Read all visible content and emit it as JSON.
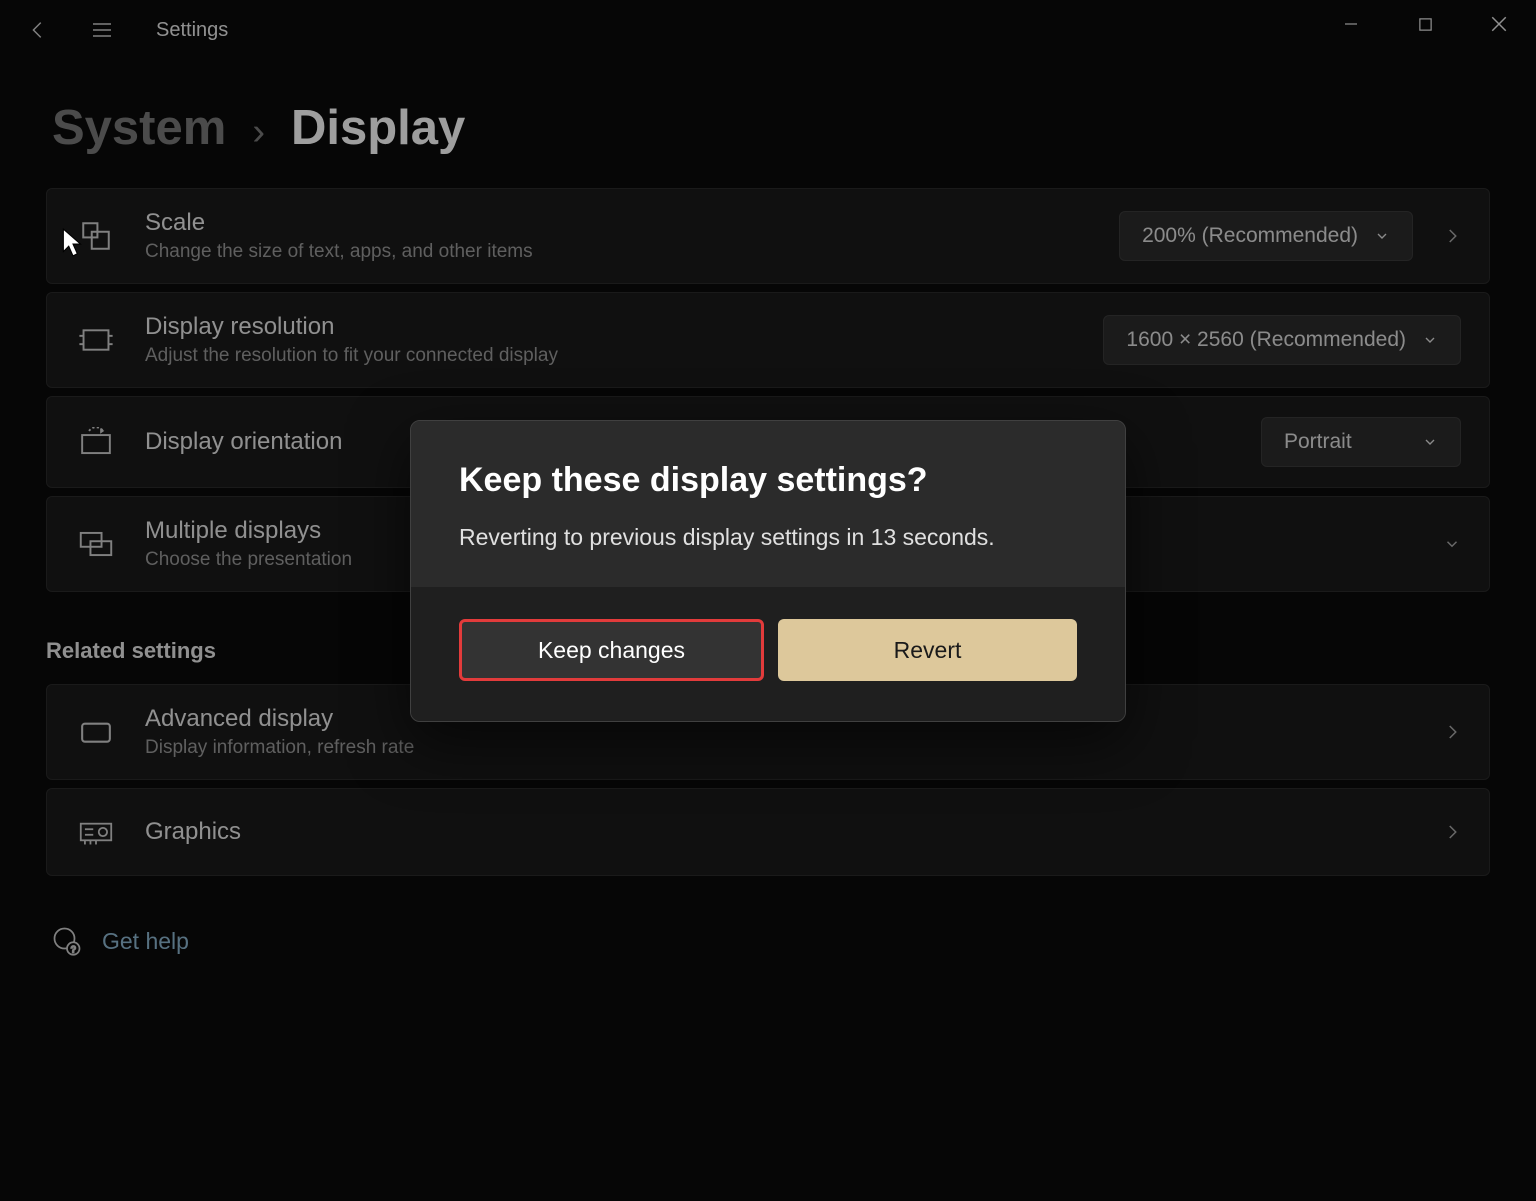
{
  "window": {
    "app_title": "Settings"
  },
  "breadcrumb": {
    "parent": "System",
    "separator": "›",
    "current": "Display"
  },
  "rows": {
    "scale": {
      "title": "Scale",
      "sub": "Change the size of text, apps, and other items",
      "value": "200% (Recommended)"
    },
    "resolution": {
      "title": "Display resolution",
      "sub": "Adjust the resolution to fit your connected display",
      "value": "1600 × 2560 (Recommended)"
    },
    "orientation": {
      "title": "Display orientation",
      "value": "Portrait"
    },
    "multiple": {
      "title": "Multiple displays",
      "sub": "Choose the presentation"
    }
  },
  "related": {
    "heading": "Related settings",
    "advanced": {
      "title": "Advanced display",
      "sub": "Display information, refresh rate"
    },
    "graphics": {
      "title": "Graphics"
    }
  },
  "help": {
    "label": "Get help"
  },
  "dialog": {
    "title": "Keep these display settings?",
    "body": "Reverting to previous display settings in 13 seconds.",
    "keep": "Keep changes",
    "revert": "Revert"
  }
}
